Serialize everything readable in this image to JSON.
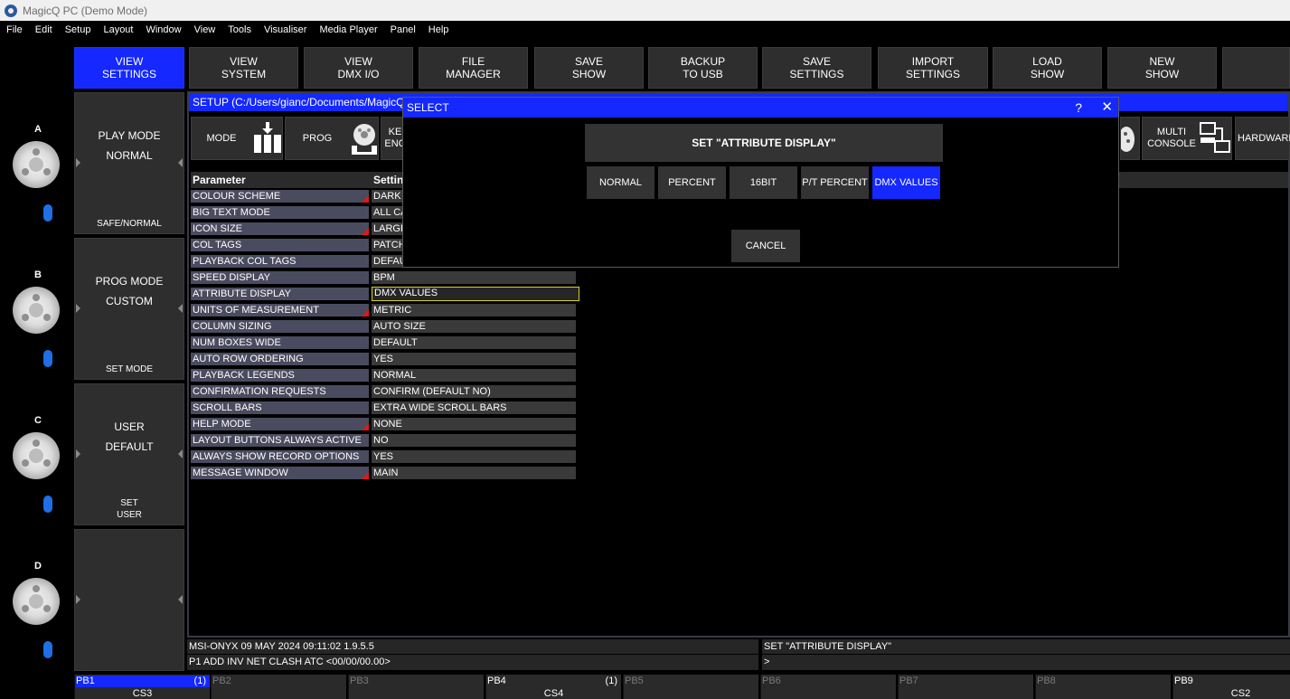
{
  "window": {
    "title": "MagicQ PC (Demo Mode)"
  },
  "menu": [
    "File",
    "Edit",
    "Setup",
    "Layout",
    "Window",
    "View",
    "Tools",
    "Visualiser",
    "Media Player",
    "Panel",
    "Help"
  ],
  "encoders": [
    "A",
    "B",
    "C",
    "D"
  ],
  "top_buttons": [
    {
      "line1": "VIEW",
      "line2": "SETTINGS"
    },
    {
      "line1": "VIEW",
      "line2": "SYSTEM"
    },
    {
      "line1": "VIEW",
      "line2": "DMX I/O"
    },
    {
      "line1": "FILE",
      "line2": "MANAGER"
    },
    {
      "line1": "SAVE",
      "line2": "SHOW"
    },
    {
      "line1": "BACKUP",
      "line2": "TO USB"
    },
    {
      "line1": "SAVE",
      "line2": "SETTINGS"
    },
    {
      "line1": "IMPORT",
      "line2": "SETTINGS"
    },
    {
      "line1": "LOAD",
      "line2": "SHOW"
    },
    {
      "line1": "NEW",
      "line2": "SHOW"
    }
  ],
  "soft_buttons": [
    {
      "line1": "PLAY MODE",
      "line2": "NORMAL",
      "foot1": "SAFE/NORMAL",
      "foot2": ""
    },
    {
      "line1": "PROG MODE",
      "line2": "CUSTOM",
      "foot1": "SET MODE",
      "foot2": ""
    },
    {
      "line1": "USER",
      "line2": "DEFAULT",
      "foot1": "SET",
      "foot2": "USER"
    },
    {
      "line1": "",
      "line2": "",
      "foot1": "",
      "foot2": ""
    }
  ],
  "setup": {
    "header": "SETUP (C:/Users/gianc/Documents/MagicQ",
    "mode_buttons": [
      "MODE",
      "PROG",
      "KE ENC",
      "MULTI CONSOLE",
      "HARDWARE"
    ],
    "col_parameter": "Parameter",
    "col_setting": "Settin",
    "rows": [
      {
        "name": "COLOUR SCHEME",
        "value": "DARK (",
        "flag": true
      },
      {
        "name": "BIG TEXT MODE",
        "value": "ALL CA",
        "flag": false
      },
      {
        "name": "ICON SIZE",
        "value": "LARGE",
        "flag": true
      },
      {
        "name": "COL TAGS",
        "value": "PATCH",
        "flag": false
      },
      {
        "name": "PLAYBACK COL TAGS",
        "value": "DEFAUL",
        "flag": false
      },
      {
        "name": "SPEED DISPLAY",
        "value": "BPM",
        "flag": false
      },
      {
        "name": "ATTRIBUTE DISPLAY",
        "value": "DMX VALUES",
        "flag": false
      },
      {
        "name": "UNITS OF MEASUREMENT",
        "value": "METRIC",
        "flag": true
      },
      {
        "name": "COLUMN SIZING",
        "value": "AUTO SIZE",
        "flag": false
      },
      {
        "name": "NUM BOXES WIDE",
        "value": "DEFAULT",
        "flag": false
      },
      {
        "name": "AUTO ROW ORDERING",
        "value": "YES",
        "flag": false
      },
      {
        "name": "PLAYBACK LEGENDS",
        "value": "NORMAL",
        "flag": false
      },
      {
        "name": "CONFIRMATION REQUESTS",
        "value": "CONFIRM (DEFAULT NO)",
        "flag": false
      },
      {
        "name": "SCROLL BARS",
        "value": "EXTRA WIDE SCROLL BARS",
        "flag": false
      },
      {
        "name": "HELP MODE",
        "value": "NONE",
        "flag": true
      },
      {
        "name": "LAYOUT BUTTONS ALWAYS ACTIVE",
        "value": "NO",
        "flag": false
      },
      {
        "name": "ALWAYS SHOW RECORD OPTIONS",
        "value": "YES",
        "flag": false
      },
      {
        "name": "MESSAGE WINDOW",
        "value": "MAIN",
        "flag": true
      }
    ]
  },
  "status": {
    "line1": "MSI-ONYX 09 MAY 2024 09:11:02 1.9.5.5",
    "line2": "P1  ADD INV NET CLASH  ATC <00/00/00.00>",
    "right1": "SET \"ATTRIBUTE DISPLAY\"",
    "right2": ">"
  },
  "playbacks": [
    {
      "name": "PB1",
      "count": "(1)",
      "sub": "CS3"
    },
    {
      "name": "PB2",
      "count": "",
      "sub": ""
    },
    {
      "name": "PB3",
      "count": "",
      "sub": ""
    },
    {
      "name": "PB4",
      "count": "(1)",
      "sub": "CS4"
    },
    {
      "name": "PB5",
      "count": "",
      "sub": ""
    },
    {
      "name": "PB6",
      "count": "",
      "sub": ""
    },
    {
      "name": "PB7",
      "count": "",
      "sub": ""
    },
    {
      "name": "PB8",
      "count": "",
      "sub": ""
    },
    {
      "name": "PB9",
      "count": "",
      "sub": "CS2"
    }
  ],
  "dialog": {
    "title": "SELECT",
    "help": "?",
    "close": "✕",
    "heading": "SET \"ATTRIBUTE DISPLAY\"",
    "options": [
      "NORMAL",
      "PERCENT",
      "16BIT",
      "P/T PERCENT",
      "DMX VALUES"
    ],
    "selected": "DMX VALUES",
    "cancel": "CANCEL"
  },
  "colors": {
    "accent_blue": "#1428ff",
    "button_gray": "#2e2e2e",
    "param_name_bg": "#4b4b60",
    "selected_outline": "#d7d21a",
    "flag_red": "#e01818",
    "encoder_led": "#1f6fe6"
  }
}
